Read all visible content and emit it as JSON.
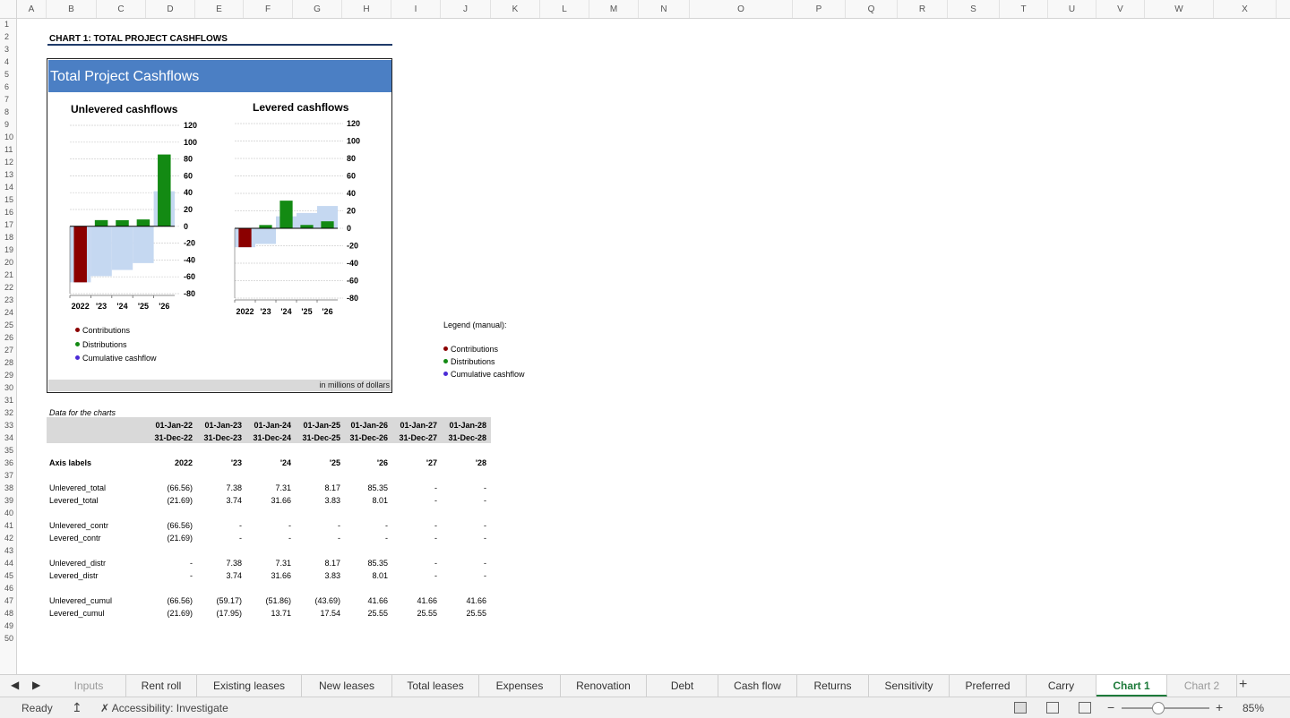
{
  "columns": [
    "A",
    "B",
    "C",
    "D",
    "E",
    "F",
    "G",
    "H",
    "I",
    "J",
    "K",
    "L",
    "M",
    "N",
    "O",
    "P",
    "Q",
    "R",
    "S",
    "T",
    "U",
    "V",
    "W",
    "X"
  ],
  "rows": [
    "1",
    "2",
    "3",
    "4",
    "5",
    "6",
    "7",
    "8",
    "9",
    "10",
    "11",
    "12",
    "13",
    "14",
    "15",
    "16",
    "17",
    "18",
    "19",
    "20",
    "21",
    "22",
    "23",
    "24",
    "25",
    "26",
    "27",
    "28",
    "29",
    "30",
    "31",
    "32",
    "33",
    "34",
    "35",
    "36",
    "37",
    "38",
    "39",
    "40",
    "41",
    "42",
    "43",
    "44",
    "45",
    "46",
    "47",
    "48",
    "49",
    "50"
  ],
  "sheet": {
    "heading": "CHART 1: TOTAL PROJECT CASHFLOWS",
    "chart_banner": "Total Project Cashflows",
    "units_note": "in millions of dollars",
    "legend_manual_title": "Legend (manual):",
    "legend": [
      {
        "label": "Contributions",
        "color": "#8b0000"
      },
      {
        "label": "Distributions",
        "color": "#138a13"
      },
      {
        "label": "Cumulative cashflow",
        "color": "#4b2bd6"
      }
    ]
  },
  "chart_data": [
    {
      "type": "bar",
      "title": "Unlevered cashflows",
      "categories": [
        "2022",
        "'23",
        "'24",
        "'25",
        "'26"
      ],
      "ylim": [
        -80,
        120
      ],
      "yticks": [
        120,
        100,
        80,
        60,
        40,
        20,
        0,
        -20,
        -40,
        -60,
        -80
      ],
      "series": [
        {
          "name": "Contributions",
          "color": "#8b0000",
          "values": [
            -66.56,
            0,
            0,
            0,
            0
          ]
        },
        {
          "name": "Distributions",
          "color": "#138a13",
          "values": [
            0,
            7.38,
            7.31,
            8.17,
            85.35
          ]
        },
        {
          "name": "Cumulative cashflow",
          "color": "#c5d8f1",
          "kind": "area",
          "values": [
            -66.56,
            -59.17,
            -51.86,
            -43.69,
            41.66
          ]
        }
      ]
    },
    {
      "type": "bar",
      "title": "Levered cashflows",
      "categories": [
        "2022",
        "'23",
        "'24",
        "'25",
        "'26"
      ],
      "ylim": [
        -80,
        120
      ],
      "yticks": [
        120,
        100,
        80,
        60,
        40,
        20,
        0,
        -20,
        -40,
        -60,
        -80
      ],
      "series": [
        {
          "name": "Contributions",
          "color": "#8b0000",
          "values": [
            -21.69,
            0,
            0,
            0,
            0
          ]
        },
        {
          "name": "Distributions",
          "color": "#138a13",
          "values": [
            0,
            3.74,
            31.66,
            3.83,
            8.01
          ]
        },
        {
          "name": "Cumulative cashflow",
          "color": "#c5d8f1",
          "kind": "area",
          "values": [
            -21.69,
            -17.95,
            13.71,
            17.54,
            25.55
          ]
        }
      ]
    }
  ],
  "table": {
    "caption": "Data for the charts",
    "start_dates": [
      "01-Jan-22",
      "01-Jan-23",
      "01-Jan-24",
      "01-Jan-25",
      "01-Jan-26",
      "01-Jan-27",
      "01-Jan-28"
    ],
    "end_dates": [
      "31-Dec-22",
      "31-Dec-23",
      "31-Dec-24",
      "31-Dec-25",
      "31-Dec-26",
      "31-Dec-27",
      "31-Dec-28"
    ],
    "axis_label_row": {
      "label": "Axis labels",
      "values": [
        "2022",
        "'23",
        "'24",
        "'25",
        "'26",
        "'27",
        "'28"
      ]
    },
    "rows": [
      {
        "label": "Unlevered_total",
        "values": [
          "(66.56)",
          "7.38",
          "7.31",
          "8.17",
          "85.35",
          "-",
          "-"
        ]
      },
      {
        "label": "Levered_total",
        "values": [
          "(21.69)",
          "3.74",
          "31.66",
          "3.83",
          "8.01",
          "-",
          "-"
        ]
      },
      {
        "label": "Unlevered_contr",
        "values": [
          "(66.56)",
          "-",
          "-",
          "-",
          "-",
          "-",
          "-"
        ]
      },
      {
        "label": "Levered_contr",
        "values": [
          "(21.69)",
          "-",
          "-",
          "-",
          "-",
          "-",
          "-"
        ]
      },
      {
        "label": "Unlevered_distr",
        "values": [
          "-",
          "7.38",
          "7.31",
          "8.17",
          "85.35",
          "-",
          "-"
        ]
      },
      {
        "label": "Levered_distr",
        "values": [
          "-",
          "3.74",
          "31.66",
          "3.83",
          "8.01",
          "-",
          "-"
        ]
      },
      {
        "label": "Unlevered_cumul",
        "values": [
          "(66.56)",
          "(59.17)",
          "(51.86)",
          "(43.69)",
          "41.66",
          "41.66",
          "41.66"
        ]
      },
      {
        "label": "Levered_cumul",
        "values": [
          "(21.69)",
          "(17.95)",
          "13.71",
          "17.54",
          "25.55",
          "25.55",
          "25.55"
        ]
      }
    ]
  },
  "tabs": [
    "Inputs",
    "Rent roll",
    "Existing leases",
    "New leases",
    "Total leases",
    "Expenses",
    "Renovation",
    "Debt",
    "Cash flow",
    "Returns",
    "Sensitivity",
    "Preferred",
    "Carry",
    "Chart 1",
    "Chart 2"
  ],
  "active_tab": "Chart 1",
  "status": {
    "ready": "Ready",
    "accessibility": "Accessibility: Investigate",
    "zoom": "85%",
    "zoom_level": 0.85
  }
}
